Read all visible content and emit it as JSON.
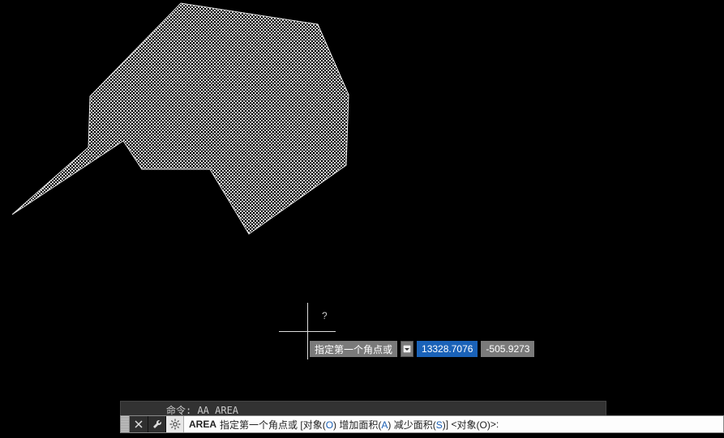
{
  "canvas": {
    "cursor_question": "?"
  },
  "dynamic_input": {
    "prompt": "指定第一个角点或",
    "x_value": "13328.7076",
    "y_value": "-505.9273"
  },
  "command_history": {
    "last": "命令: AA AREA"
  },
  "command_line": {
    "cmd_name": "AREA",
    "prompt_prefix": "指定第一个角点或 [",
    "opt1_label": "对象",
    "opt1_key": "O",
    "opt2_label": "增加面积",
    "opt2_key": "A",
    "opt3_label": "减少面积",
    "opt3_key": "S",
    "default_prefix": "] <",
    "default_label": "对象",
    "default_key": "O",
    "suffix": ">:"
  },
  "icons": {
    "close": "close-icon",
    "wrench": "wrench-icon",
    "gear": "gear-icon",
    "dropdown": "dropdown-icon"
  }
}
